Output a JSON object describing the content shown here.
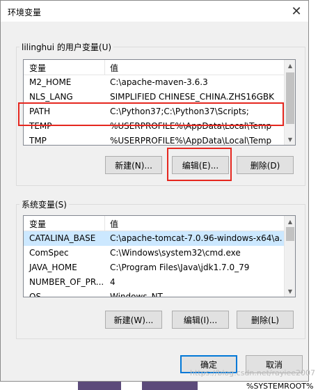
{
  "window": {
    "title": "环境变量",
    "close_glyph": "✕"
  },
  "user_vars": {
    "label": "lilinghui 的用户变量(U)",
    "columns": [
      "变量",
      "值"
    ],
    "rows": [
      {
        "name": "M2_HOME",
        "value": "C:\\apache-maven-3.6.3"
      },
      {
        "name": "NLS_LANG",
        "value": "SIMPLIFIED CHINESE_CHINA.ZHS16GBK"
      },
      {
        "name": "PATH",
        "value": "C:\\Python37;C:\\Python37\\Scripts;"
      },
      {
        "name": "TEMP",
        "value": "%USERPROFILE%\\AppData\\Local\\Temp"
      },
      {
        "name": "TMP",
        "value": "%USERPROFILE%\\AppData\\Local\\Temp"
      }
    ],
    "buttons": {
      "new": "新建(N)...",
      "edit": "编辑(E)...",
      "delete": "删除(D)"
    }
  },
  "system_vars": {
    "label": "系统变量(S)",
    "columns": [
      "变量",
      "值"
    ],
    "rows": [
      {
        "name": "CATALINA_BASE",
        "value": "C:\\apache-tomcat-7.0.96-windows-x64\\a..."
      },
      {
        "name": "ComSpec",
        "value": "C:\\Windows\\system32\\cmd.exe"
      },
      {
        "name": "JAVA_HOME",
        "value": "C:\\Program Files\\Java\\jdk1.7.0_79"
      },
      {
        "name": "NUMBER_OF_PR...",
        "value": "4"
      },
      {
        "name": "OS",
        "value": "Windows_NT"
      }
    ],
    "buttons": {
      "new": "新建(W)...",
      "edit": "编辑(I)...",
      "delete": "删除(L)"
    }
  },
  "footer": {
    "ok": "确定",
    "cancel": "取消"
  },
  "watermark": "https://blog.csdn.net/rayiee2007",
  "background_snippet": "%SYSTEMROOT%"
}
